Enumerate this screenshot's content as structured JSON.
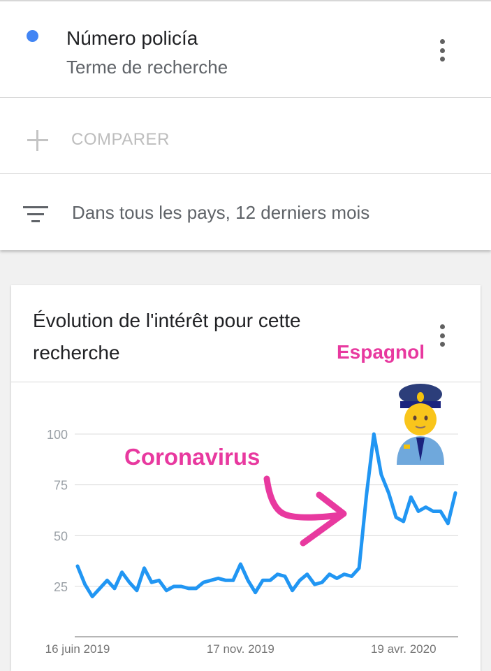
{
  "search_term": {
    "title": "Número policía",
    "subtitle": "Terme de recherche",
    "dot_color": "#4285f4",
    "menu_icon": "more-vert-icon"
  },
  "compare": {
    "icon": "plus-icon",
    "label": "COMPARER"
  },
  "filter": {
    "icon": "filter-list-icon",
    "label": "Dans tous les pays, 12 derniers mois"
  },
  "card": {
    "title": "Évolution de l'intérêt pour cette recherche",
    "menu_icon": "more-vert-icon"
  },
  "annotations": {
    "espagnol": "Espagnol",
    "coronavirus": "Coronavirus",
    "arrow_color": "#e8399f",
    "emoji": "police-officer-emoji"
  },
  "chart_data": {
    "type": "line",
    "series_color": "#2196f3",
    "ylim": [
      0,
      100
    ],
    "y_ticks": [
      25,
      50,
      75,
      100
    ],
    "x_tick_labels": [
      "16 juin 2019",
      "17 nov. 2019",
      "19 avr. 2020"
    ],
    "x_tick_index": [
      0,
      22,
      44
    ],
    "grid": true,
    "values": [
      35,
      26,
      20,
      24,
      28,
      24,
      32,
      27,
      23,
      34,
      27,
      28,
      23,
      25,
      25,
      24,
      24,
      27,
      28,
      29,
      28,
      28,
      36,
      28,
      22,
      28,
      28,
      31,
      30,
      23,
      28,
      31,
      26,
      27,
      31,
      29,
      31,
      30,
      34,
      70,
      100,
      80,
      71,
      59,
      57,
      69,
      62,
      64,
      62,
      62,
      56,
      71
    ]
  }
}
